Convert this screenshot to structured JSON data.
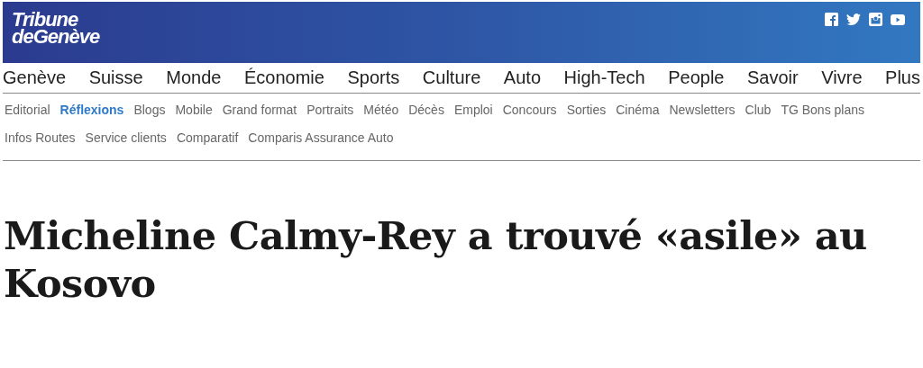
{
  "logo": {
    "line_1": "Tribune",
    "line_2": "deGenève"
  },
  "social": [
    {
      "kind": "facebook"
    },
    {
      "kind": "twitter"
    },
    {
      "kind": "instagram"
    },
    {
      "kind": "youtube"
    }
  ],
  "main_nav": [
    "Genève",
    "Suisse",
    "Monde",
    "Économie",
    "Sports",
    "Culture",
    "Auto",
    "High-Tech",
    "People",
    "Savoir",
    "Vivre",
    "Plus"
  ],
  "sub_nav": [
    {
      "label": "Editorial",
      "selected": false
    },
    {
      "label": "Réflexions",
      "selected": true
    },
    {
      "label": "Blogs",
      "selected": false
    },
    {
      "label": "Mobile",
      "selected": false
    },
    {
      "label": "Grand format",
      "selected": false
    },
    {
      "label": "Portraits",
      "selected": false
    },
    {
      "label": "Météo",
      "selected": false
    },
    {
      "label": "Décès",
      "selected": false
    },
    {
      "label": "Emploi",
      "selected": false
    },
    {
      "label": "Concours",
      "selected": false
    },
    {
      "label": "Sorties",
      "selected": false
    },
    {
      "label": "Cinéma",
      "selected": false
    },
    {
      "label": "Newsletters",
      "selected": false
    },
    {
      "label": "Club",
      "selected": false
    },
    {
      "label": "TG Bons plans",
      "selected": false
    },
    {
      "label": "Infos Routes",
      "selected": false
    },
    {
      "label": "Service clients",
      "selected": false
    },
    {
      "label": "Comparatif",
      "selected": false
    },
    {
      "label": "Comparis Assurance Auto",
      "selected": false
    }
  ],
  "article": {
    "title": "Micheline Calmy-Rey a trouvé «asile» au Kosovo"
  }
}
